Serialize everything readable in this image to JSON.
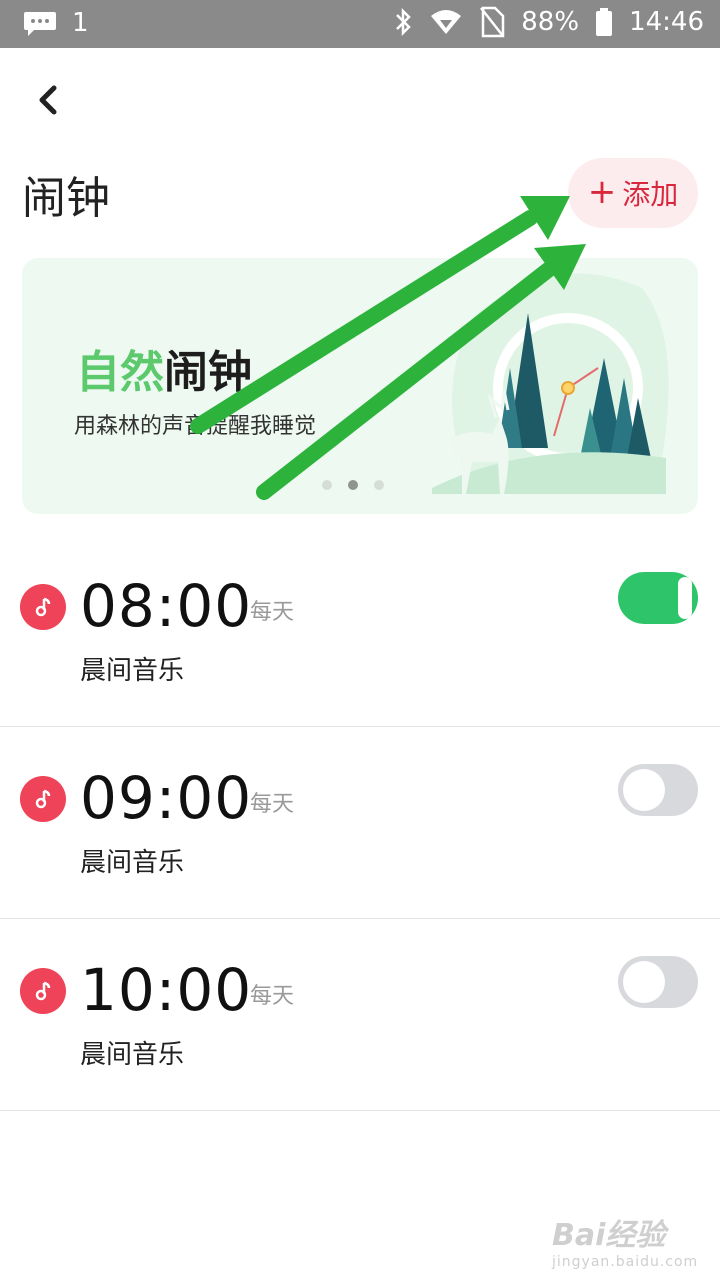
{
  "status_bar": {
    "notification_count": "1",
    "battery": "88%",
    "time": "14:46"
  },
  "header": {
    "title": "闹钟",
    "add_plus": "+",
    "add_label": "添加"
  },
  "banner": {
    "title_highlight": "自然",
    "title_rest": "闹钟",
    "subtitle": "用森林的声音提醒我睡觉",
    "page_index": 2,
    "page_count": 3
  },
  "alarms": [
    {
      "time": "08:00",
      "repeat": "每天",
      "label": "晨间音乐",
      "enabled": true
    },
    {
      "time": "09:00",
      "repeat": "每天",
      "label": "晨间音乐",
      "enabled": false
    },
    {
      "time": "10:00",
      "repeat": "每天",
      "label": "晨间音乐",
      "enabled": false
    }
  ],
  "watermark": {
    "brand": "Bai经验",
    "url": "jingyan.baidu.com"
  },
  "colors": {
    "accent_red": "#d9283e",
    "toggle_on": "#2ec56a",
    "banner_green": "#5bc96c",
    "annotation_arrow": "#2db33c"
  },
  "icons": [
    "chat-bubble-icon",
    "bluetooth-icon",
    "wifi-icon",
    "no-sim-icon",
    "battery-icon",
    "back-icon",
    "music-note-icon"
  ]
}
